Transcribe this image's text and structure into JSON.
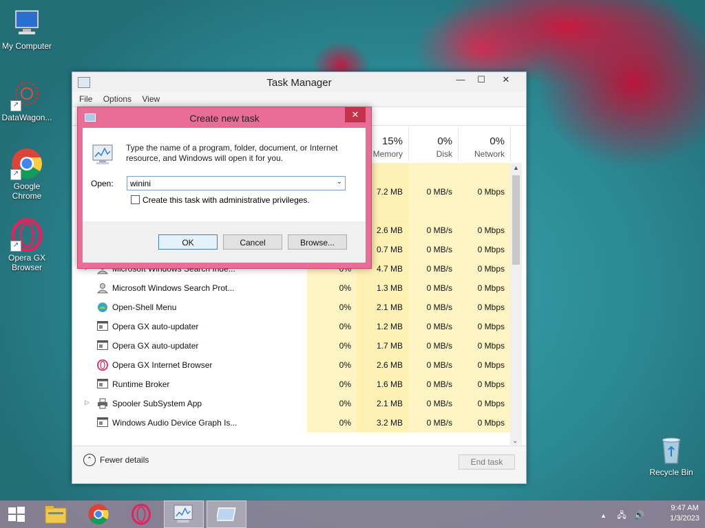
{
  "desktop": {
    "icons": [
      {
        "label": "My Computer"
      },
      {
        "label": "DataWagon..."
      },
      {
        "label": "Google Chrome"
      },
      {
        "label": "Opera GX Browser"
      },
      {
        "label": "Recycle Bin"
      }
    ]
  },
  "task_manager": {
    "title": "Task Manager",
    "menu": [
      "File",
      "Options",
      "View"
    ],
    "columns": [
      {
        "pct": "15%",
        "label": "Memory"
      },
      {
        "pct": "0%",
        "label": "Disk"
      },
      {
        "pct": "0%",
        "label": "Network"
      }
    ],
    "visible_values": [
      {
        "mem": "7.2 MB",
        "disk": "0 MB/s",
        "net": "0 Mbps"
      },
      {
        "mem": "2.6 MB",
        "disk": "0 MB/s",
        "net": "0 Mbps"
      },
      {
        "mem": "0.7 MB",
        "disk": "0 MB/s",
        "net": "0 Mbps"
      }
    ],
    "processes": [
      {
        "name": "Microsoft Windows Search Inde...",
        "cpu": "0%",
        "mem": "4.7 MB",
        "disk": "0 MB/s",
        "net": "0 Mbps",
        "expand": true,
        "icon": "user-icon"
      },
      {
        "name": "Microsoft Windows Search Prot...",
        "cpu": "0%",
        "mem": "1.3 MB",
        "disk": "0 MB/s",
        "net": "0 Mbps",
        "expand": false,
        "icon": "user-icon"
      },
      {
        "name": "Open-Shell Menu",
        "cpu": "0%",
        "mem": "2.1 MB",
        "disk": "0 MB/s",
        "net": "0 Mbps",
        "expand": false,
        "icon": "shell-icon"
      },
      {
        "name": "Opera GX auto-updater",
        "cpu": "0%",
        "mem": "1.2 MB",
        "disk": "0 MB/s",
        "net": "0 Mbps",
        "expand": false,
        "icon": "app-window-icon"
      },
      {
        "name": "Opera GX auto-updater",
        "cpu": "0%",
        "mem": "1.7 MB",
        "disk": "0 MB/s",
        "net": "0 Mbps",
        "expand": false,
        "icon": "app-window-icon"
      },
      {
        "name": "Opera GX Internet Browser",
        "cpu": "0%",
        "mem": "2.6 MB",
        "disk": "0 MB/s",
        "net": "0 Mbps",
        "expand": false,
        "icon": "opera-icon"
      },
      {
        "name": "Runtime Broker",
        "cpu": "0%",
        "mem": "1.6 MB",
        "disk": "0 MB/s",
        "net": "0 Mbps",
        "expand": false,
        "icon": "app-window-icon"
      },
      {
        "name": "Spooler SubSystem App",
        "cpu": "0%",
        "mem": "2.1 MB",
        "disk": "0 MB/s",
        "net": "0 Mbps",
        "expand": true,
        "icon": "printer-icon"
      },
      {
        "name": "Windows Audio Device Graph Is...",
        "cpu": "0%",
        "mem": "3.2 MB",
        "disk": "0 MB/s",
        "net": "0 Mbps",
        "expand": false,
        "icon": "app-window-icon"
      }
    ],
    "fewer_details": "Fewer details",
    "end_task": "End task"
  },
  "dialog": {
    "title": "Create new task",
    "description": "Type the name of a program, folder, document, or Internet resource, and Windows will open it for you.",
    "open_label": "Open:",
    "open_value": "winini",
    "admin_label": "Create this task with administrative privileges.",
    "ok": "OK",
    "cancel": "Cancel",
    "browse": "Browse..."
  },
  "taskbar": {
    "time": "9:47 AM",
    "date": "1/3/2023"
  }
}
